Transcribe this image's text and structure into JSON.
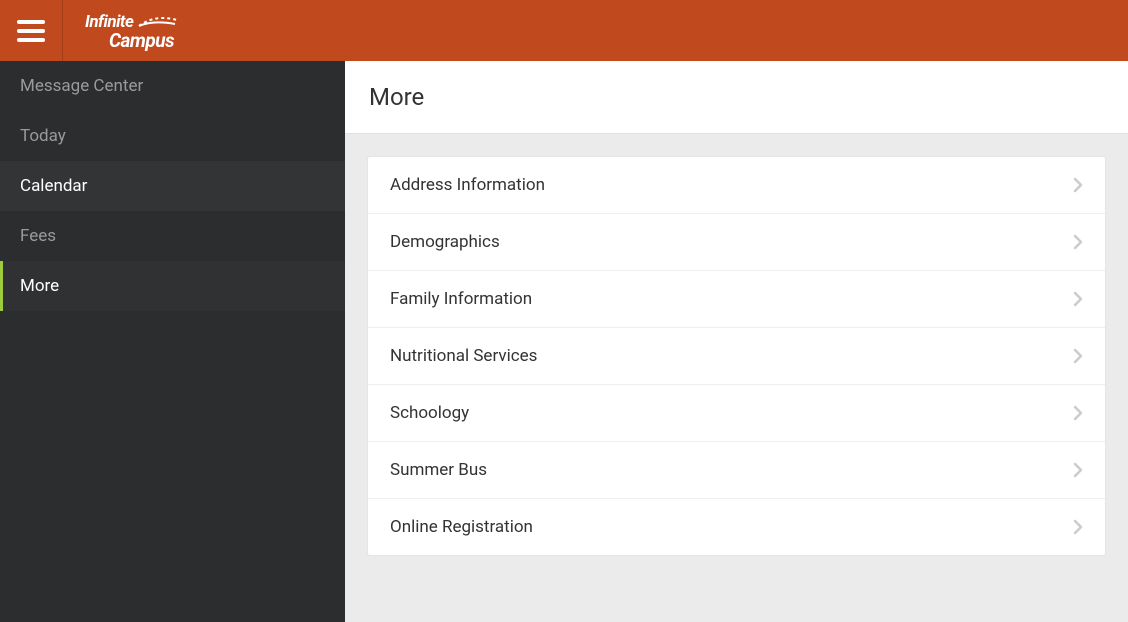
{
  "brand": {
    "top": "Infinite",
    "bottom": "Campus"
  },
  "sidebar": {
    "items": [
      {
        "label": "Message Center"
      },
      {
        "label": "Today"
      },
      {
        "label": "Calendar"
      },
      {
        "label": "Fees"
      },
      {
        "label": "More"
      }
    ]
  },
  "page": {
    "title": "More"
  },
  "list": {
    "items": [
      {
        "label": "Address Information"
      },
      {
        "label": "Demographics"
      },
      {
        "label": "Family Information"
      },
      {
        "label": "Nutritional Services"
      },
      {
        "label": "Schoology"
      },
      {
        "label": "Summer Bus"
      },
      {
        "label": "Online Registration"
      }
    ]
  }
}
